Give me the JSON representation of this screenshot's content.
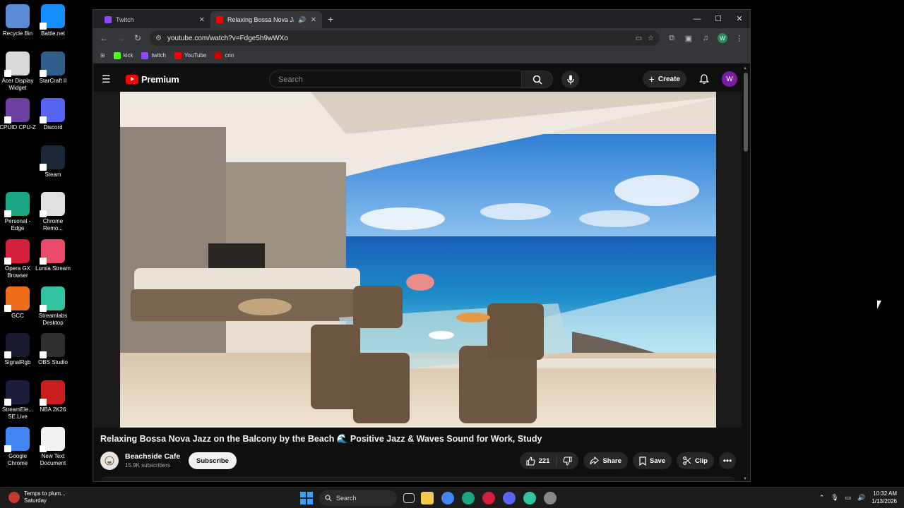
{
  "desktop": {
    "icons": [
      {
        "label": "Recycle Bin",
        "color": "#5b8bd6"
      },
      {
        "label": "Battle.net",
        "color": "#148eff"
      },
      {
        "label": "Acer Display Widget",
        "color": "#d9d9d9"
      },
      {
        "label": "StarCraft II",
        "color": "#2f5f8a"
      },
      {
        "label": "CPUID CPU-Z",
        "color": "#6b3fa0"
      },
      {
        "label": "Discord",
        "color": "#5865f2"
      },
      {
        "label": "Steam",
        "color": "#1b2838"
      },
      {
        "label": "Personal - Edge",
        "color": "#1ba784"
      },
      {
        "label": "Chrome Remo...",
        "color": "#e0e0e0"
      },
      {
        "label": "Opera GX Browser",
        "color": "#d41f3a"
      },
      {
        "label": "Lumia Stream",
        "color": "#e84b6a"
      },
      {
        "label": "GCC",
        "color": "#ef6c1a"
      },
      {
        "label": "Streamlabs Desktop",
        "color": "#31c3a2"
      },
      {
        "label": "SignalRgb",
        "color": "#1a1a2e"
      },
      {
        "label": "OBS Studio",
        "color": "#302e31"
      },
      {
        "label": "StreamEle... SE.Live",
        "color": "#1b1b3a"
      },
      {
        "label": "NBA 2K26",
        "color": "#c81e1e"
      },
      {
        "label": "Google Chrome",
        "color": "#4285f4"
      },
      {
        "label": "New Text Document",
        "color": "#f2f2f2"
      }
    ]
  },
  "browser": {
    "tabs": [
      {
        "label": "Twitch",
        "favicon_color": "#9146ff",
        "active": false
      },
      {
        "label": "Relaxing Bossa Nova Jazz o",
        "favicon_color": "#ff0000",
        "active": true
      }
    ],
    "new_tab": "+",
    "window_controls": {
      "minimize": "—",
      "maximize": "☐",
      "close": "✕"
    },
    "url": "youtube.com/watch?v=Fdge5h9wWXo",
    "profile_initial": "W",
    "bookmarks": [
      {
        "label": "kick",
        "color": "#53fc18"
      },
      {
        "label": "twitch",
        "color": "#9146ff"
      },
      {
        "label": "YouTube",
        "color": "#ff0000"
      },
      {
        "label": "cnn",
        "color": "#cc0000"
      }
    ]
  },
  "youtube": {
    "logo_text": "Premium",
    "search_placeholder": "Search",
    "create_label": "Create",
    "avatar_initial": "W",
    "video_title": "Relaxing Bossa Nova Jazz on the Balcony by the Beach 🌊 Positive Jazz & Waves Sound for Work, Study",
    "channel_name": "Beachside Cafe",
    "subscribers": "15.9K subscribers",
    "subscribe_label": "Subscribe",
    "likes": "221",
    "share_label": "Share",
    "save_label": "Save",
    "clip_label": "Clip",
    "more_label": "•••"
  },
  "taskbar": {
    "weather_title": "Temps to plum...",
    "weather_sub": "Saturday",
    "search_label": "Search",
    "time": "10:32 AM",
    "date": "1/13/2026",
    "apps": [
      {
        "name": "file-explorer",
        "color": "#f2c94c"
      },
      {
        "name": "chrome",
        "color": "#4285f4"
      },
      {
        "name": "edge",
        "color": "#1ba784"
      },
      {
        "name": "opera-gx",
        "color": "#d41f3a"
      },
      {
        "name": "discord",
        "color": "#5865f2"
      },
      {
        "name": "streamlabs",
        "color": "#31c3a2"
      },
      {
        "name": "steam-settings",
        "color": "#888888"
      }
    ]
  }
}
